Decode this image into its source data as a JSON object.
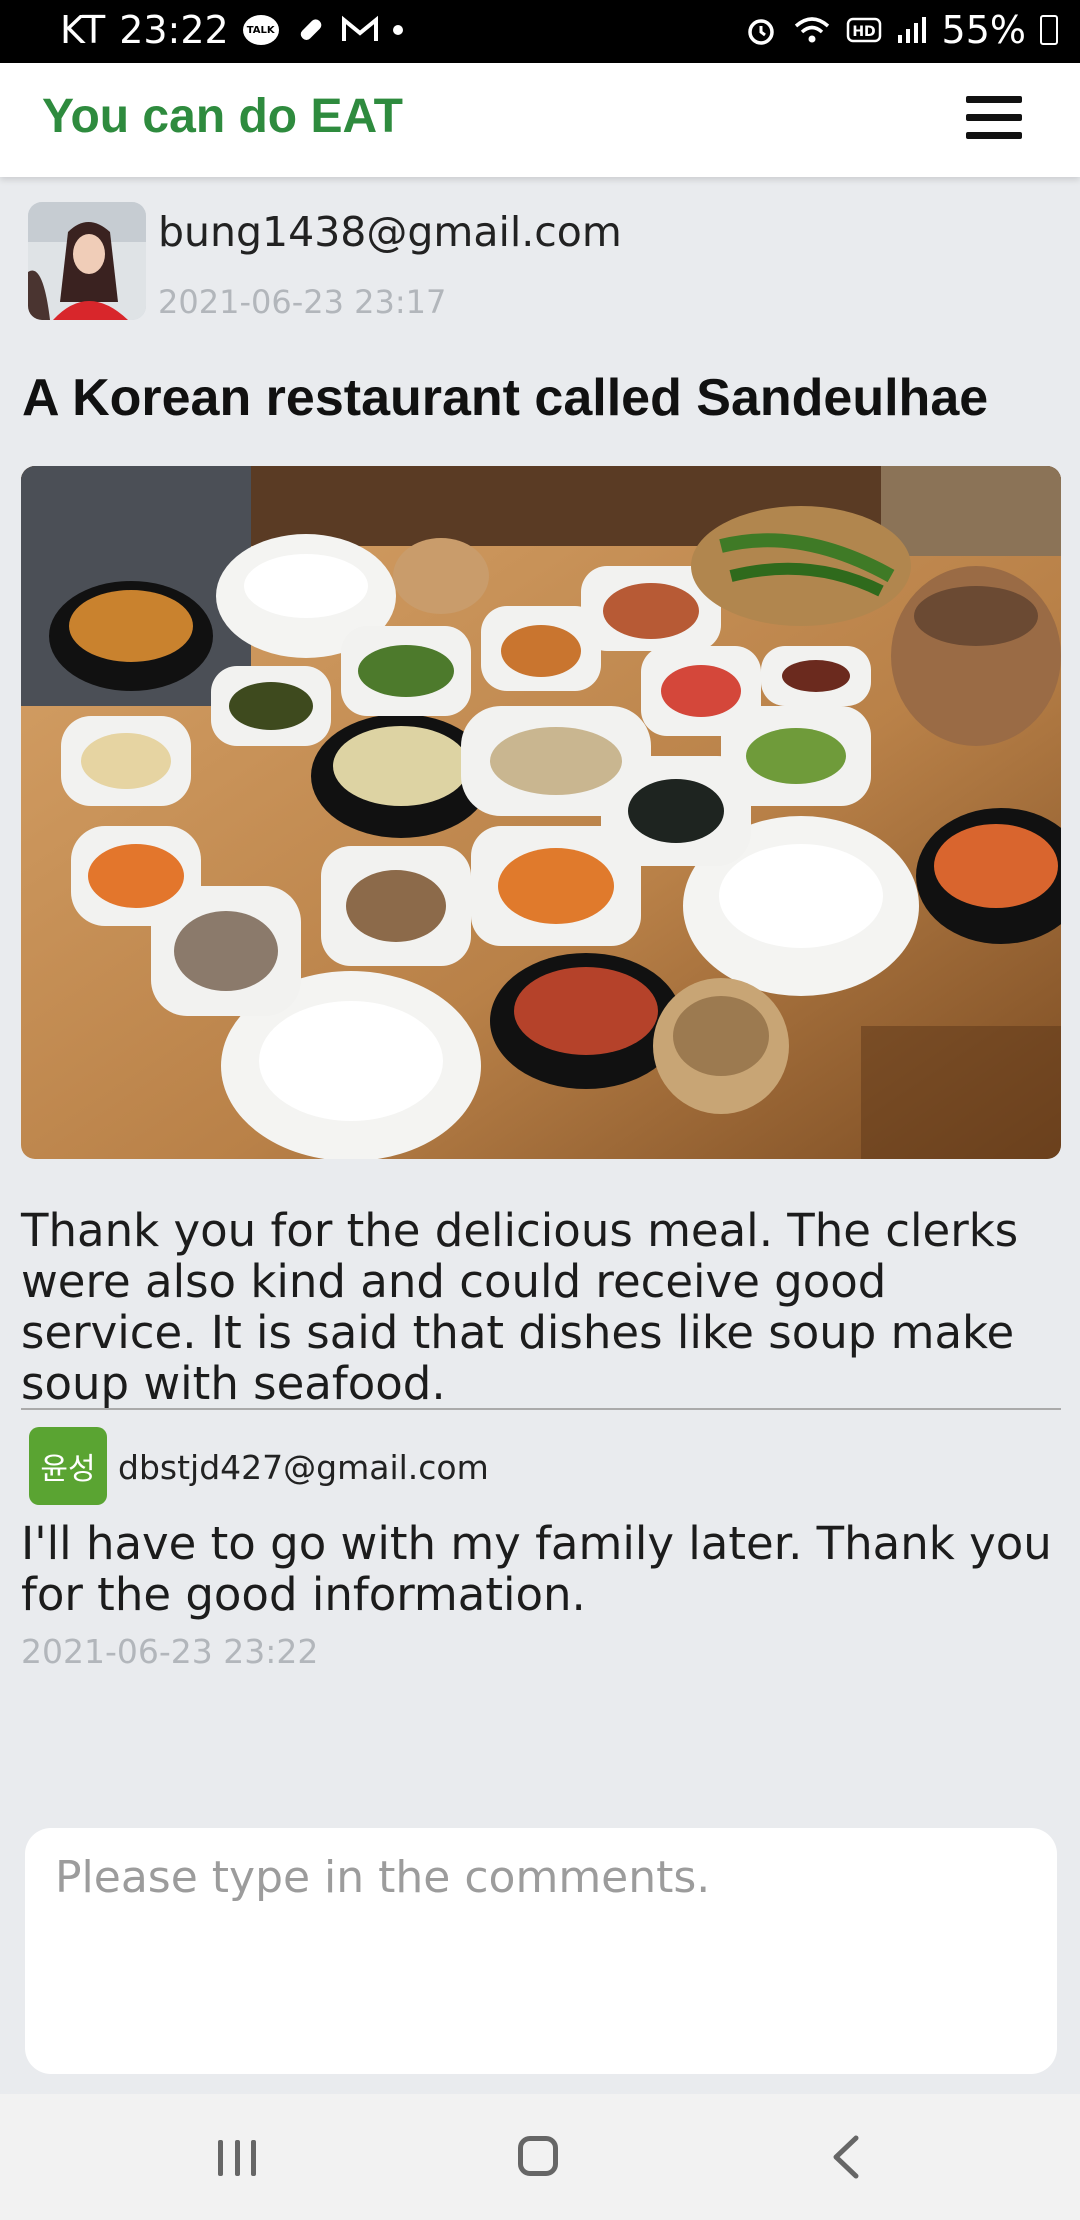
{
  "status_bar": {
    "carrier": "KT",
    "time": "23:22",
    "battery": "55%",
    "icons": [
      "kakaotalk-icon",
      "bandage-icon",
      "gmail-icon",
      "alarm-icon",
      "wifi-icon",
      "hd-icon",
      "signal-icon",
      "battery-icon"
    ]
  },
  "app_bar": {
    "title": "You can do EAT",
    "menu_icon": "hamburger-menu-icon"
  },
  "post": {
    "author": "bung1438@gmail.com",
    "timestamp": "2021-06-23 23:17",
    "title": "A Korean restaurant called Sandeulhae",
    "body": "Thank you for the delicious meal. The clerks were also kind and could receive good service. It is said that dishes like soup make soup with seafood."
  },
  "comments": [
    {
      "avatar_text": "윤성",
      "author": "dbstjd427@gmail.com",
      "text": "I'll have to go with my family later. Thank you for the good information.",
      "timestamp": "2021-06-23 23:22"
    }
  ],
  "comment_input": {
    "placeholder": "Please type in the comments."
  },
  "colors": {
    "brand_green": "#2e8b3e",
    "avatar_green": "#5aa432",
    "page_background": "#e9ebee"
  }
}
